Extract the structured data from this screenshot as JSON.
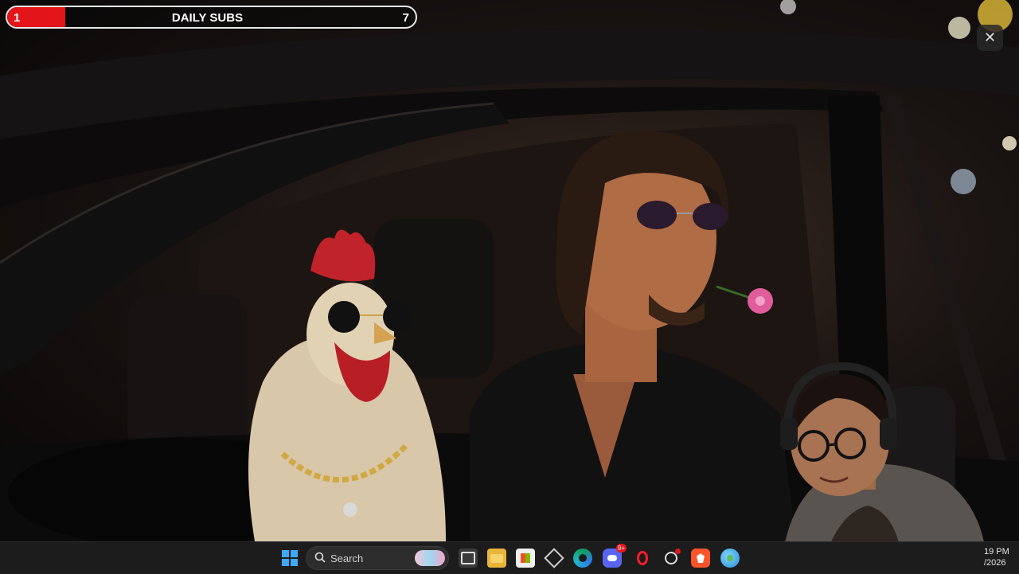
{
  "subs_goal": {
    "title": "DAILY SUBS",
    "current": "1",
    "goal": "7",
    "progress_fraction": 0.142857
  },
  "overlay": {
    "close_icon": "close-icon"
  },
  "taskbar": {
    "search_label": "Search",
    "apps": [
      "start-icon",
      "task-view-icon",
      "file-explorer-icon",
      "microsoft-store-icon",
      "app-icon",
      "edge-icon",
      "discord-icon",
      "opera-icon",
      "app-with-badge-icon",
      "brave-icon",
      "globe-app-icon"
    ],
    "discord_badge": "9+",
    "clock_time": "19 PM",
    "clock_date": "/2026"
  },
  "colors": {
    "accent_red": "#e3151a",
    "taskbar_bg": "#1c1c1c"
  }
}
